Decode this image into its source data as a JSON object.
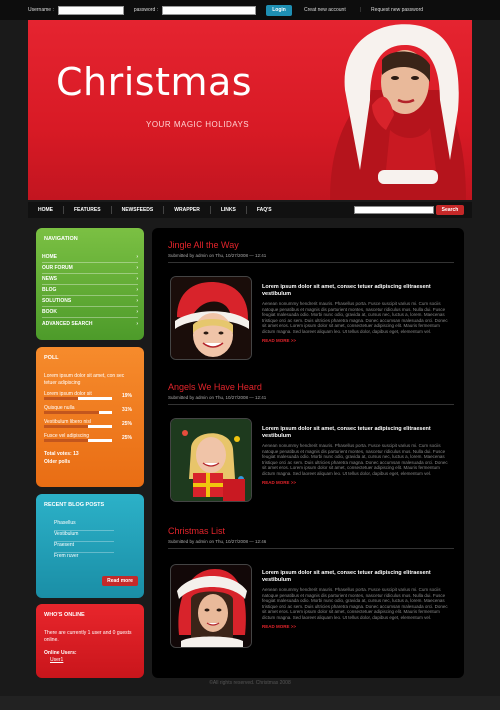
{
  "topbar": {
    "username_label": "Username :",
    "password_label": "password :",
    "login_label": "Login",
    "create_account": "Creat new account",
    "request_password": "Request new password"
  },
  "banner": {
    "title": "Christmas",
    "tagline": "YOUR MAGIC HOLIDAYS"
  },
  "nav": {
    "items": [
      "HOME",
      "FEATURES",
      "NEWSFEEDS",
      "WRAPPER",
      "LINKS",
      "FAQ'S"
    ],
    "search_label": "Search"
  },
  "sidebar": {
    "navigation": {
      "title": "NAVIGATION",
      "items": [
        {
          "label": "HOME",
          "arrow": "›"
        },
        {
          "label": "OUR FORUM",
          "arrow": "›"
        },
        {
          "label": "NEWS",
          "arrow": "›"
        },
        {
          "label": "BLOG",
          "arrow": "›"
        },
        {
          "label": "SOLUTIONS",
          "arrow": "›"
        },
        {
          "label": "BOOK",
          "arrow": "›"
        },
        {
          "label": "ADVANCED SEARCH",
          "arrow": "›"
        }
      ]
    },
    "poll": {
      "title": "POLL",
      "question": "Lorem ipsum dolor sit amet, con sec tetuer adipiscing",
      "options": [
        {
          "label": "Lorem ipsum dolor sit",
          "percent": "19%",
          "value": 19
        },
        {
          "label": "Quisque nulla",
          "percent": "31%",
          "value": 31
        },
        {
          "label": "Vestibulum libero nisl",
          "percent": "25%",
          "value": 25
        },
        {
          "label": "Fusce vel adipiscing",
          "percent": "25%",
          "value": 25
        }
      ],
      "total": "Total votes: 13",
      "older": "Older polls"
    },
    "blog": {
      "title": "RECENT BLOG POSTS",
      "items": [
        "Phasellus",
        "Vestibulum",
        "Praesent",
        "Frem ruver"
      ],
      "more": "Read more"
    },
    "online": {
      "title": "WHO'S ONLINE",
      "text": "There are currently 1 user and 0 guests online.",
      "users_label": "Online Users:",
      "user": "User1"
    }
  },
  "posts": [
    {
      "title": "Jingle All the Way",
      "meta": "Submitted by admin on Thu, 10/27/2008 — 12:41",
      "lead": "Lorem ipsum dolor sit amet, consec tetuer adipiscing elitraesent vestibulum",
      "text": "Aenean nonummy hendrerit mauris. Phasellus porta. Fusce suscipit varius mi. Cum sociis natoque penatibus et magnis dis parturient montes, nascetur ridiculus mus. Nulla dui. Fusce feugiat malesuada odio. Morbi nunc odio, gravida at, cursus nec, luctus a, lorem. Maecenas tristique orci ac sem. Duis ultricies pharetra magna. Donec accumsan malesuada orci. Donec sit amet eros. Lorem ipsum dolor sit amet, consectetuer adipiscing elit. Mauris fermentum dictum magna. Sed laoreet aliquam leo. Ut tellus dolor, dapibus eget, elementum vel.",
      "read_more": "READ MORE >>"
    },
    {
      "title": "Angels We Have Heard",
      "meta": "Submitted by admin on Thu, 10/27/2008 — 12:41",
      "lead": "Lorem ipsum dolor sit amet, consec tetuer adipiscing elitraesent vestibulum",
      "text": "Aenean nonummy hendrerit mauris. Phasellus porta. Fusce suscipit varius mi. Cum sociis natoque penatibus et magnis dis parturient montes, nascetur ridiculus mus. Nulla dui. Fusce feugiat malesuada odio. Morbi nunc odio, gravida at, cursus nec, luctus a, lorem. Maecenas tristique orci ac sem. Duis ultricies pharetra magna. Donec accumsan malesuada orci. Donec sit amet eros. Lorem ipsum dolor sit amet, consectetuer adipiscing elit. Mauris fermentum dictum magna. Sed laoreet aliquam leo. Ut tellus dolor, dapibus eget, elementum vel.",
      "read_more": "READ MORE >>"
    },
    {
      "title": "Christmas List",
      "meta": "Submitted by admin on Thu, 10/27/2008 — 12:46",
      "lead": "Lorem ipsum dolor sit amet, consec tetuer adipiscing elitraesent vestibulum",
      "text": "Aenean nonummy hendrerit mauris. Phasellus porta. Fusce suscipit varius mi. Cum sociis natoque penatibus et magnis dis parturient montes, nascetur ridiculus mus. Nulla dui. Fusce feugiat malesuada odio. Morbi nunc odio, gravida at, cursus nec, luctus a, lorem. Maecenas tristique orci ac sem. Duis ultricies pharetra magna. Donec accumsan malesuada orci. Donec sit amet eros. Lorem ipsum dolor sit amet, consectetuer adipiscing elit. Mauris fermentum dictum magna. Sed laoreet aliquam leo. Ut tellus dolor, dapibus eget, elementum vel.",
      "read_more": "READ MORE >>"
    }
  ],
  "footer": "©All rights reserved. Christmas 2008"
}
